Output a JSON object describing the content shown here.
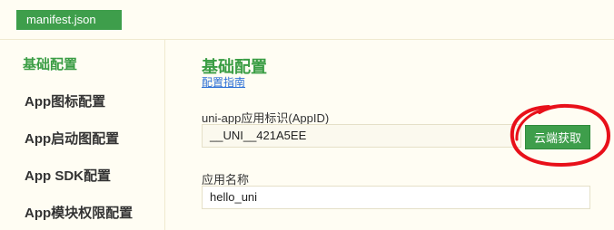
{
  "file_tab": {
    "label": "manifest.json"
  },
  "sidebar": {
    "items": [
      {
        "label": "基础配置",
        "active": true
      },
      {
        "label": "App图标配置",
        "active": false
      },
      {
        "label": "App启动图配置",
        "active": false
      },
      {
        "label": "App SDK配置",
        "active": false
      },
      {
        "label": "App模块权限配置",
        "active": false
      }
    ]
  },
  "main": {
    "title": "基础配置",
    "guide_link": "配置指南",
    "appid": {
      "label": "uni-app应用标识(AppID)",
      "value": "__UNI__421A5EE",
      "button_label": "云端获取"
    },
    "app_name": {
      "label": "应用名称",
      "value": "hello_uni"
    }
  },
  "colors": {
    "accent": "#3e9e4b",
    "active_text": "#3a9d44",
    "link": "#2b6fd6",
    "annotation": "#e8101a",
    "background": "#fffdf3"
  }
}
